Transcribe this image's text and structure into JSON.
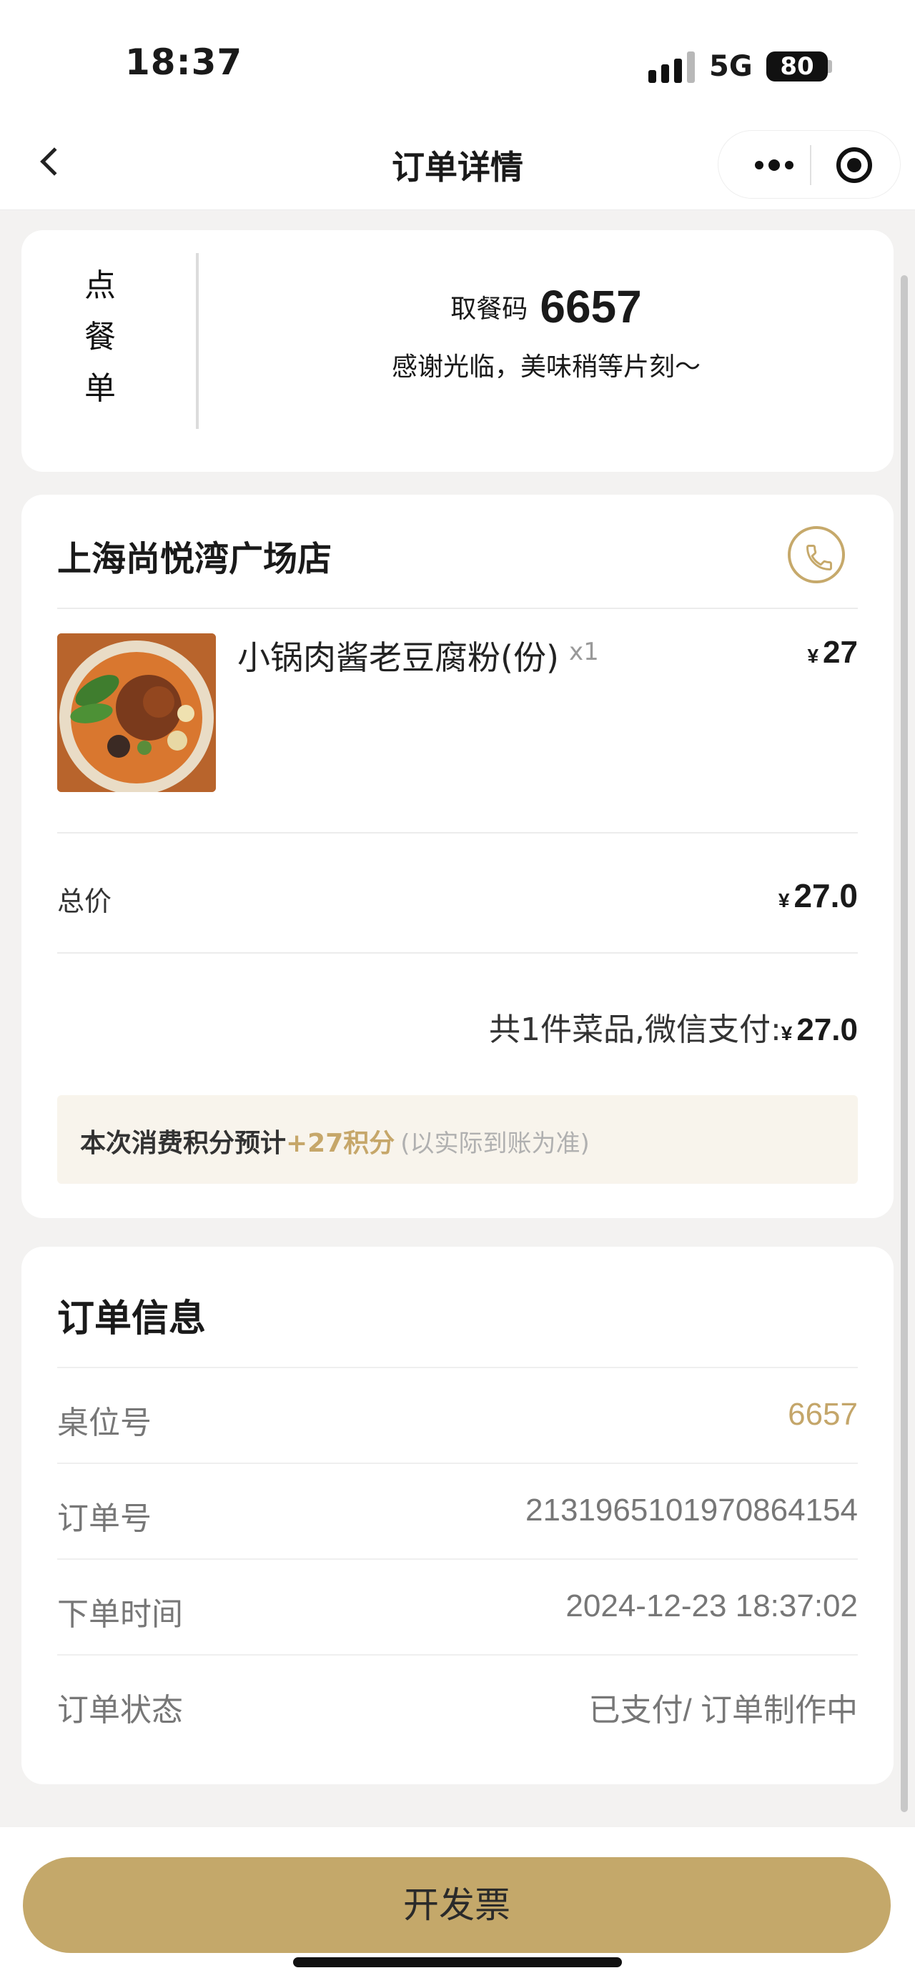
{
  "status_bar": {
    "time": "18:37",
    "network": "5G",
    "battery": "80"
  },
  "nav": {
    "title": "订单详情"
  },
  "pickup": {
    "tag": [
      "点",
      "餐",
      "单"
    ],
    "label": "取餐码",
    "code": "6657",
    "message": "感谢光临，美味稍等片刻～"
  },
  "order_items": {
    "store_name": "上海尚悦湾广场店",
    "items": [
      {
        "name": "小锅肉酱老豆腐粉(份)",
        "qty": "x1",
        "currency": "¥",
        "price": "27"
      }
    ],
    "total_label": "总价",
    "total_currency": "¥",
    "total_value": "27.0",
    "summary_text": "共1件菜品,微信支付:",
    "summary_currency": "¥",
    "summary_value": "27.0",
    "points": {
      "prefix": "本次消费积分预计",
      "value": "+27积分",
      "note": "(以实际到账为准)"
    }
  },
  "order_info": {
    "title": "订单信息",
    "rows": [
      {
        "key": "桌位号",
        "value": "6657"
      },
      {
        "key": "订单号",
        "value": "2131965101970864154"
      },
      {
        "key": "下单时间",
        "value": "2024-12-23 18:37:02"
      },
      {
        "key": "订单状态",
        "value": "已支付/ 订单制作中"
      }
    ]
  },
  "bottom": {
    "invoice_button": "开发票"
  },
  "colors": {
    "accent_gold": "#c4a86a",
    "background": "#f3f2f1"
  },
  "icons": [
    "back-arrow",
    "more-dots",
    "miniapp-close-target",
    "phone"
  ]
}
